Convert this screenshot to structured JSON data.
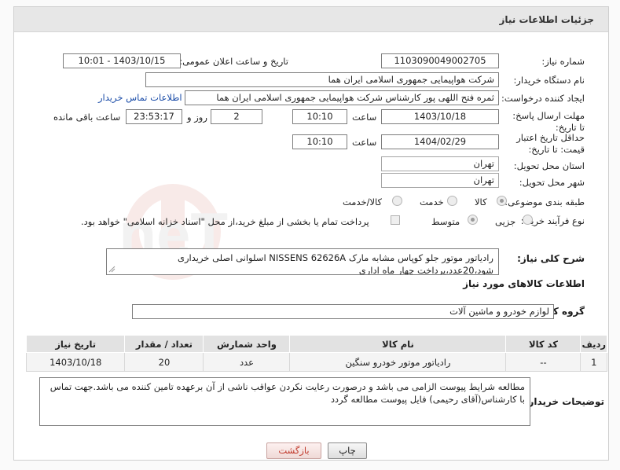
{
  "header": {
    "title": "جزئیات اطلاعات نیاز"
  },
  "fields": {
    "need_number_label": "شماره نیاز:",
    "need_number": "1103090049002705",
    "announce_label": "تاریخ و ساعت اعلان عمومی:",
    "announce_value": "1403/10/15 - 10:01",
    "buyer_org_label": "نام دستگاه خریدار:",
    "buyer_org": "شرکت هواپیمایی جمهوری اسلامی ایران هما",
    "creator_label": "ایجاد کننده درخواست:",
    "creator": "ثمره فتح اللهی پور کارشناس شرکت هواپیمایی جمهوری اسلامی ایران هما",
    "buyer_contact_link": "اطلاعات تماس خریدار",
    "deadline_label": "مهلت ارسال پاسخ: تا تاریخ:",
    "deadline_date": "1403/10/18",
    "time_label": "ساعت",
    "deadline_time": "10:10",
    "days_value": "2",
    "days_label": "روز و",
    "remaining_time": "23:53:17",
    "remaining_label": "ساعت باقی مانده",
    "price_validity_label": "حداقل تاریخ اعتبار قیمت: تا تاریخ:",
    "price_validity_date": "1404/02/29",
    "price_validity_time": "10:10",
    "province_label": "استان محل تحویل:",
    "province": "تهران",
    "city_label": "شهر محل تحویل:",
    "city": "تهران",
    "category_label": "طبقه بندی موضوعی:",
    "category_options": [
      "کالا",
      "خدمت",
      "کالا/خدمت"
    ],
    "purchase_type_label": "نوع فرآیند خرید :",
    "purchase_options": [
      "جزیی",
      "متوسط"
    ],
    "payment_note": "پرداخت تمام یا بخشی از مبلغ خرید،از محل \"اسناد خزانه اسلامی\" خواهد بود."
  },
  "summary": {
    "label": "شرح کلی نیاز:",
    "text": "رادیاتور موتور جلو کوپاس مشابه مارک  NISSENS 62626A  اسلوانی اصلی خریداری شود،20عدد،پرداخت چهار ماه اداری"
  },
  "goods_info_title": "اطلاعات کالاهای مورد نیاز",
  "goods_group": {
    "label": "گروه کالا:",
    "value": "لوازم خودرو و ماشین آلات"
  },
  "table": {
    "headers": [
      "ردیف",
      "کد کالا",
      "نام کالا",
      "واحد شمارش",
      "تعداد / مقدار",
      "تاریخ نیاز"
    ],
    "rows": [
      [
        "1",
        "--",
        "رادیاتور موتور خودرو سنگین",
        "عدد",
        "20",
        "1403/10/18"
      ]
    ]
  },
  "buyer_notes": {
    "label": "توضیحات خریدار:",
    "text": "مطالعه شرایط پیوست الزامی می باشد و درصورت رعایت نکردن عواقب ناشی از آن برعهده تامین کننده می باشد.جهت تماس با کارشناس(آقای رحیمی) فایل پیوست مطالعه گردد"
  },
  "buttons": {
    "print": "چاپ",
    "back": "بازگشت"
  },
  "watermark": {
    "text": "AriaTender.neT"
  },
  "colors": {
    "link": "#1a4ca8",
    "back_button_text": "#c0392b",
    "header_bg": "#e7e7e7"
  }
}
